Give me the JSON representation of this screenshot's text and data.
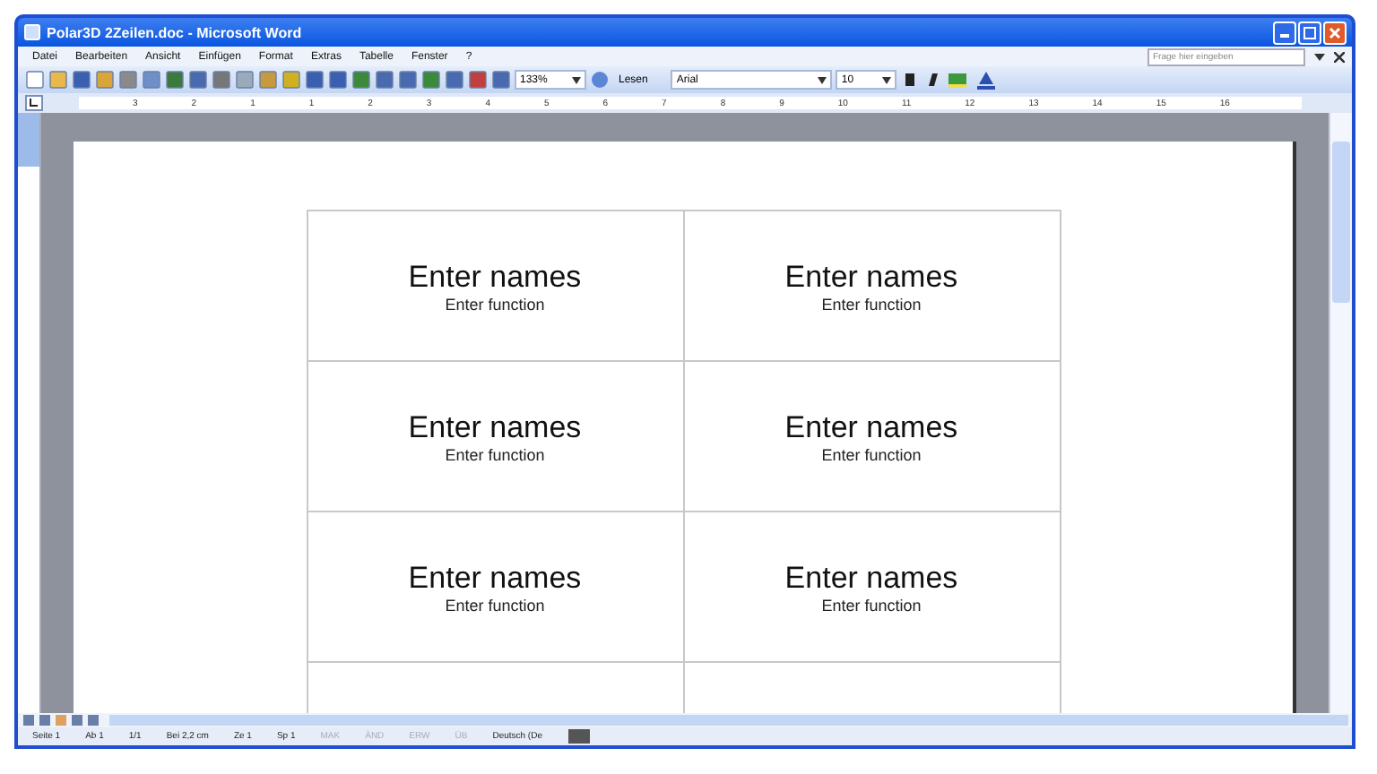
{
  "window": {
    "title": "Polar3D 2Zeilen.doc - Microsoft Word"
  },
  "menu": [
    "Datei",
    "Bearbeiten",
    "Ansicht",
    "Einfügen",
    "Format",
    "Extras",
    "Tabelle",
    "Fenster",
    "?"
  ],
  "help_box": {
    "placeholder": "Frage hier eingeben"
  },
  "toolbar": {
    "zoom": "133%",
    "read_button": "Lesen",
    "font": "Arial",
    "size": "10"
  },
  "ruler": {
    "labels": [
      "3",
      "2",
      "1",
      "1",
      "2",
      "3",
      "4",
      "5",
      "6",
      "7",
      "8",
      "9",
      "10",
      "11",
      "12",
      "13",
      "14",
      "15",
      "16"
    ]
  },
  "labels_table": {
    "rows": [
      [
        {
          "name": "Enter names",
          "function": "Enter function"
        },
        {
          "name": "Enter names",
          "function": "Enter function"
        }
      ],
      [
        {
          "name": "Enter names",
          "function": "Enter function"
        },
        {
          "name": "Enter names",
          "function": "Enter function"
        }
      ],
      [
        {
          "name": "Enter names",
          "function": "Enter function"
        },
        {
          "name": "Enter names",
          "function": "Enter function"
        }
      ],
      [
        {},
        {}
      ]
    ]
  },
  "status_bar": [
    {
      "text": "Seite 1",
      "disabled": false
    },
    {
      "text": "Ab 1",
      "disabled": false
    },
    {
      "text": "1/1",
      "disabled": false
    },
    {
      "text": "Bei 2,2 cm",
      "disabled": false
    },
    {
      "text": "Ze 1",
      "disabled": false
    },
    {
      "text": "Sp 1",
      "disabled": false
    },
    {
      "text": "MAK",
      "disabled": true
    },
    {
      "text": "ÄND",
      "disabled": true
    },
    {
      "text": "ERW",
      "disabled": true
    },
    {
      "text": "ÜB",
      "disabled": true
    },
    {
      "text": "Deutsch (De",
      "disabled": false
    }
  ]
}
